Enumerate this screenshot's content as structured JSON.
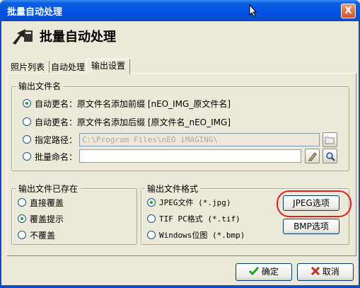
{
  "window": {
    "title": "批量自动处理",
    "close_glyph": "X"
  },
  "header": {
    "title": "批量自动处理",
    "icon": "scanner-arrow-icon"
  },
  "tabs": [
    {
      "label": "照片列表",
      "active": false
    },
    {
      "label": "自动处理",
      "active": false
    },
    {
      "label": "输出设置",
      "active": true
    }
  ],
  "output_name": {
    "group_label": "输出文件名",
    "options": [
      {
        "label": "自动更名：原文件名添加前缀 [nEO_IMG_原文件名]",
        "selected": true
      },
      {
        "label": "自动更名：原文件名添加后缀 [原文件名_nEO_IMG]",
        "selected": false
      },
      {
        "label": "指定路径：",
        "selected": false
      },
      {
        "label": "批量命名：",
        "selected": false
      }
    ],
    "path_value": "C:\\Program Files\\nEO iMAGING\\",
    "rename_value": ""
  },
  "exists": {
    "group_label": "输出文件已存在",
    "options": [
      {
        "label": "直接覆盖",
        "selected": false
      },
      {
        "label": "覆盖提示",
        "selected": true
      },
      {
        "label": "不覆盖",
        "selected": false
      }
    ]
  },
  "format": {
    "group_label": "输出文件格式",
    "options": [
      {
        "label": "JPEG文件 (*.jpg)",
        "selected": true
      },
      {
        "label": "TIF PC格式 (*.tif)",
        "selected": false
      },
      {
        "label": "Windows位图 (*.bmp)",
        "selected": false
      }
    ],
    "jpeg_button": "JPEG选项",
    "bmp_button": "BMP选项"
  },
  "footer": {
    "ok": "确定",
    "cancel": "取消"
  },
  "colors": {
    "titlebar": "#0053E1",
    "highlight_circle": "#E02020",
    "ok_check": "#21A121",
    "cancel_x": "#C0302A"
  }
}
